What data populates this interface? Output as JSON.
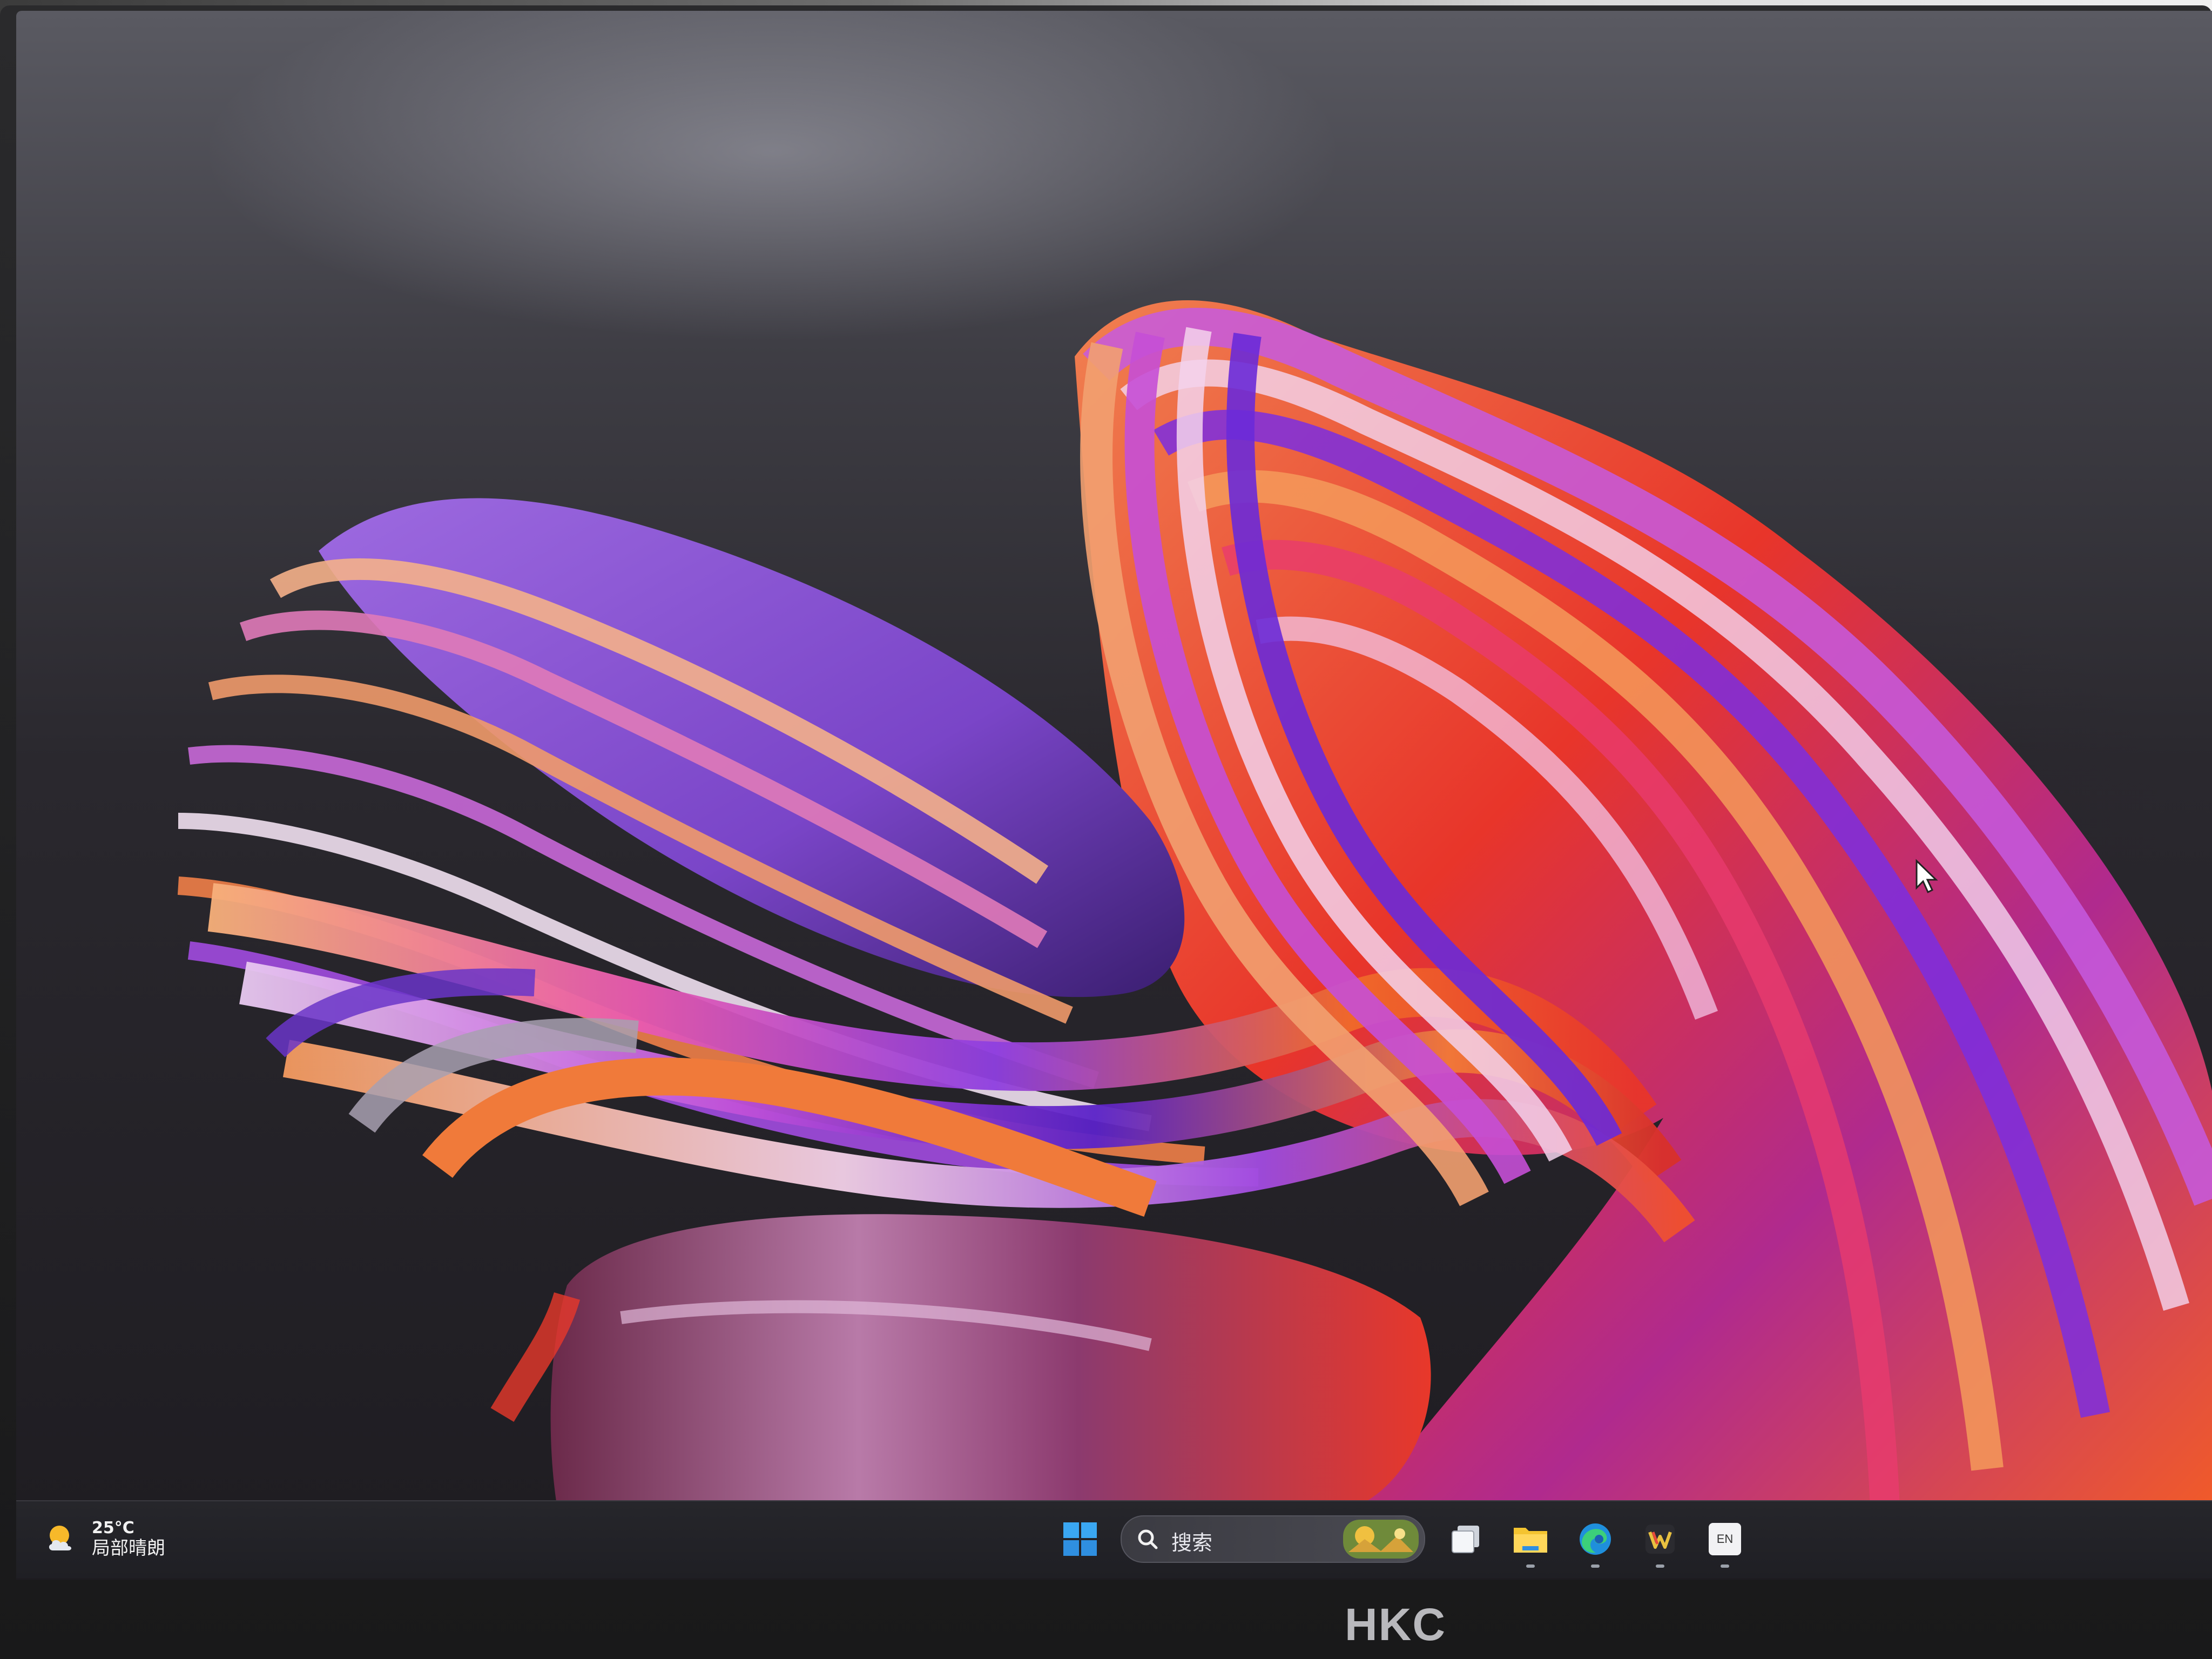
{
  "monitor": {
    "brand": "HKC"
  },
  "taskbar": {
    "weather": {
      "temperature": "25°C",
      "condition": "局部晴朗",
      "icon": "partly-sunny-icon"
    },
    "start": {
      "icon": "windows-start-icon"
    },
    "search": {
      "label": "搜索",
      "icon": "search-icon"
    },
    "apps": [
      {
        "name": "task-view",
        "icon": "task-view-icon"
      },
      {
        "name": "file-explorer",
        "icon": "folder-icon"
      },
      {
        "name": "edge",
        "icon": "edge-browser-icon"
      },
      {
        "name": "wps",
        "icon": "wps-office-icon"
      },
      {
        "name": "input-method",
        "icon": "en-keyboard-icon",
        "label": "EN"
      }
    ]
  },
  "desktop": {
    "wallpaper": "Windows 11 colorful ribbon swirl",
    "cursor": "arrow-pointer"
  },
  "colors": {
    "accent_purple": "#8a4dd6",
    "accent_orange": "#f06a2a",
    "accent_red": "#e8352a",
    "taskbar_bg": "#222227"
  }
}
